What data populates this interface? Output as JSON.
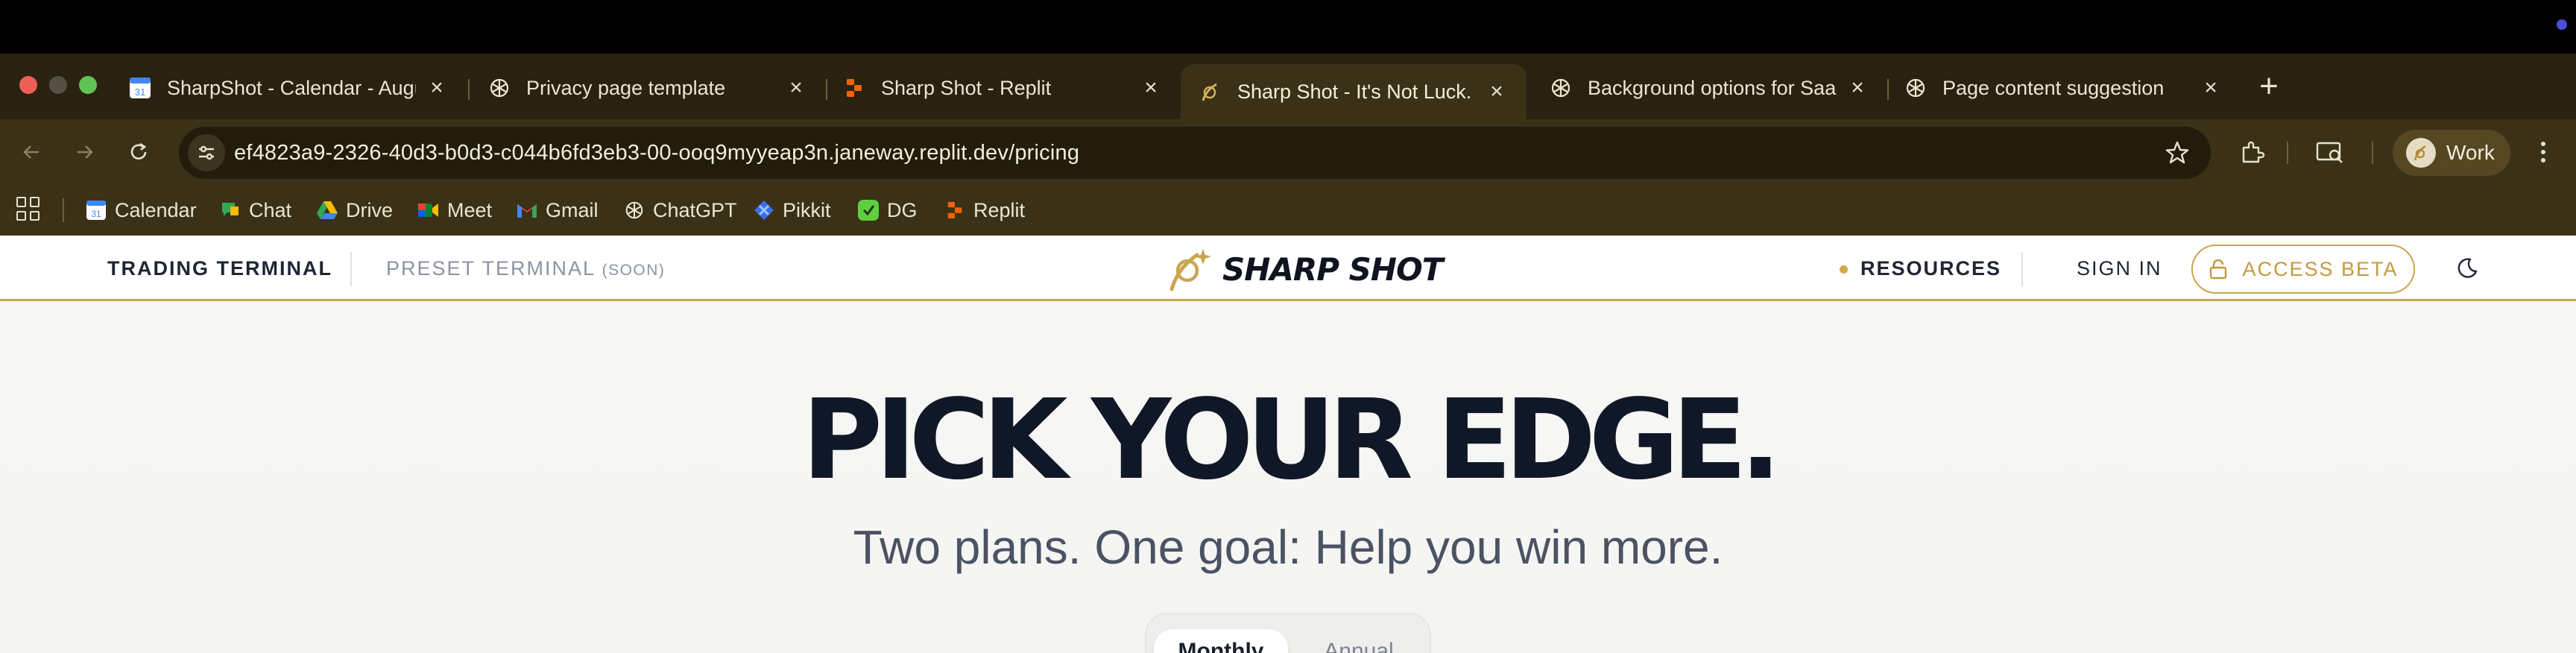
{
  "browser": {
    "tabs": [
      {
        "title": "SharpShot - Calendar - August",
        "icon": "google-calendar-icon",
        "active": false
      },
      {
        "title": "Privacy page template",
        "icon": "chatgpt-icon",
        "active": false
      },
      {
        "title": "Sharp Shot - Replit",
        "icon": "replit-icon",
        "active": false
      },
      {
        "title": "Sharp Shot - It's Not Luck. It's",
        "icon": "sharpshot-icon",
        "active": true
      },
      {
        "title": "Background options for SaaS",
        "icon": "chatgpt-icon",
        "active": false
      },
      {
        "title": "Page content suggestion",
        "icon": "chatgpt-icon",
        "active": false
      }
    ],
    "new_tab_label": "+",
    "url": "ef4823a9-2326-40d3-b0d3-c044b6fd3eb3-00-ooq9myyeap3n.janeway.replit.dev/pricing",
    "profile_label": "Work",
    "bookmarks": [
      {
        "label": "Calendar",
        "icon": "google-calendar-icon"
      },
      {
        "label": "Chat",
        "icon": "google-chat-icon"
      },
      {
        "label": "Drive",
        "icon": "google-drive-icon"
      },
      {
        "label": "Meet",
        "icon": "google-meet-icon"
      },
      {
        "label": "Gmail",
        "icon": "gmail-icon"
      },
      {
        "label": "ChatGPT",
        "icon": "chatgpt-icon"
      },
      {
        "label": "Pikkit",
        "icon": "pikkit-icon"
      },
      {
        "label": "DG",
        "icon": "dg-icon"
      },
      {
        "label": "Replit",
        "icon": "replit-icon"
      }
    ],
    "calendar_icon_day": "31"
  },
  "site": {
    "nav_left": {
      "trading_terminal": "TRADING TERMINAL",
      "preset_terminal": "PRESET TERMINAL",
      "preset_soon": "(SOON)"
    },
    "logo_text": "SHARP SHOT",
    "nav_right": {
      "resources": "RESOURCES",
      "sign_in": "SIGN IN",
      "access_beta": "ACCESS BETA"
    },
    "accent_color": "#c9a651"
  },
  "hero": {
    "title": "PICK YOUR EDGE.",
    "subtitle": "Two plans. One goal: Help you win more.",
    "billing_options": [
      "Monthly",
      "Annual"
    ],
    "billing_selected": "Monthly"
  }
}
